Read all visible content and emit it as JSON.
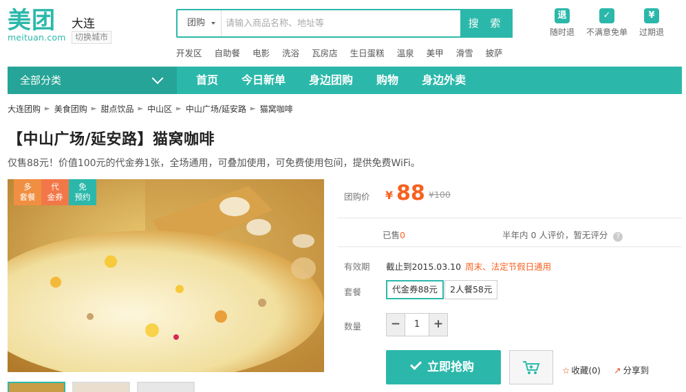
{
  "header": {
    "logo_text": "美团",
    "logo_url_text": "meituan.com",
    "city": "大连",
    "switch_city": "切换城市",
    "search": {
      "category": "团购",
      "placeholder": "请输入商品名称、地址等",
      "button": "搜 索"
    },
    "hot_words": [
      "开发区",
      "自助餐",
      "电影",
      "洗浴",
      "瓦房店",
      "生日蛋糕",
      "温泉",
      "美甲",
      "滑雪",
      "披萨"
    ],
    "promises": [
      {
        "icon": "refund-anytime-icon",
        "glyph": "退",
        "label": "随时退"
      },
      {
        "icon": "check-icon",
        "glyph": "✓",
        "label": "不满意免单"
      },
      {
        "icon": "yen-icon",
        "glyph": "¥",
        "label": "过期退"
      }
    ]
  },
  "nav": {
    "all_categories": "全部分类",
    "items": [
      "首页",
      "今日新单",
      "身边团购",
      "购物",
      "身边外卖"
    ]
  },
  "breadcrumb": [
    "大连团购",
    "美食团购",
    "甜点饮品",
    "中山区",
    "中山广场/延安路",
    "猫窝咖啡"
  ],
  "deal": {
    "title": "【中山广场/延安路】猫窝咖啡",
    "subtitle": "仅售88元！价值100元的代金券1张，全场通用，可叠加使用，可免费使用包间，提供免费WiFi。",
    "tags": [
      {
        "line1": "多",
        "line2": "套餐"
      },
      {
        "line1": "代",
        "line2": "金券"
      },
      {
        "line1": "免",
        "line2": "预约"
      }
    ],
    "price_label": "团购价",
    "currency": "¥",
    "price": "88",
    "original_price": "¥100",
    "sold_label": "已售",
    "sold_count": "0",
    "rating_text": "半年内 0 人评价，暂无评分",
    "rating_help": "?",
    "valid_label": "有效期",
    "valid_until": "截止到2015.03.10",
    "valid_note": "周末、法定节假日通用",
    "package_label": "套餐",
    "packages": [
      "代金券88元",
      "2人餐58元"
    ],
    "qty_label": "数量",
    "qty_minus": "−",
    "qty_value": "1",
    "qty_plus": "+",
    "buy_button": "立即抢购",
    "favorite": "收藏(0)",
    "share": "分享到"
  },
  "colors": {
    "brand": "#2bb8aa",
    "price": "#f76120",
    "tag_orange": "#f08f42",
    "tag_red": "#f27748"
  }
}
